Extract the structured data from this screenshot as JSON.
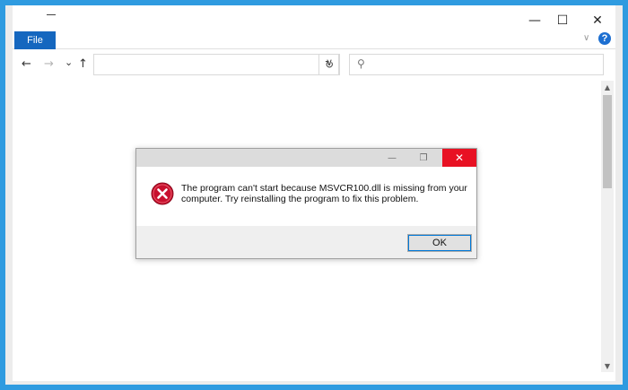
{
  "window": {
    "minimize_glyph": "—",
    "maximize_glyph": "☐",
    "close_glyph": "✕"
  },
  "ribbon": {
    "file_tab": "File",
    "collapse_glyph": "∨",
    "help_glyph": "?"
  },
  "nav": {
    "back_glyph": "←",
    "forward_glyph": "→",
    "recent_glyph": "⌄",
    "up_glyph": "↑",
    "address_value": "",
    "address_dropdown_glyph": "∨",
    "refresh_glyph": "↻",
    "search_glyph": "⚲",
    "search_value": ""
  },
  "scrollbar": {
    "up_glyph": "▲",
    "down_glyph": "▼"
  },
  "dialog": {
    "minimize_glyph": "—",
    "restore_glyph": "❐",
    "close_glyph": "✕",
    "icon": "error-icon",
    "message": "The program can't start because MSVCR100.dll is missing from your computer. Try reinstalling the program to fix this problem.",
    "ok_label": "OK"
  },
  "colors": {
    "desktop_accent": "#2f9be0",
    "file_tab": "#1567bf",
    "close_red": "#e81123",
    "error_red": "#c8102e"
  }
}
